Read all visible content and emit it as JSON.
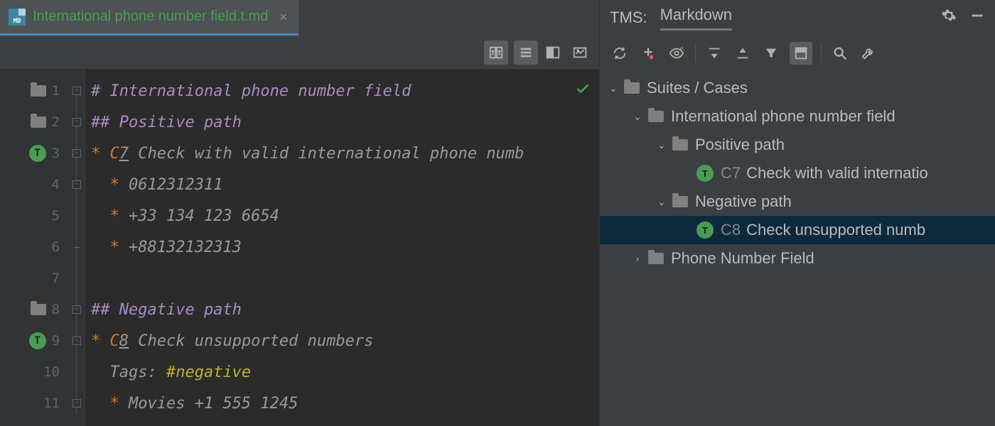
{
  "tab": {
    "icon_label": "MD",
    "title": "International phone number field.t.md"
  },
  "editor": {
    "lines": {
      "l1": "# International phone number field",
      "l2": "## Positive path",
      "l3_pre": "* C",
      "l3_link": "7",
      "l3_post": " Check with valid international phone numb",
      "l4_bullet": "  * ",
      "l4_text": "0612312311",
      "l5_bullet": "  * ",
      "l5_text": "+33 134 123 6654",
      "l6_bullet": "  * ",
      "l6_text": "+88132132313",
      "l8": "## Negative path",
      "l9_pre": "* C",
      "l9_link": "8",
      "l9_post": " Check unsupported numbers",
      "l10_pre": "  Tags: ",
      "l10_tag": "#negative",
      "l11_bullet": "  * ",
      "l11_text": "Movies +1 555 1245"
    },
    "line_numbers": [
      "1",
      "2",
      "3",
      "4",
      "5",
      "6",
      "7",
      "8",
      "9",
      "10",
      "11"
    ],
    "gutter_badge": "T"
  },
  "tms": {
    "label": "TMS:",
    "tab": "Markdown",
    "tree": {
      "root": "Suites / Cases",
      "suite": "International phone number field",
      "pos_path": "Positive path",
      "case7_no": "C7",
      "case7_title": "Check with valid internatio",
      "neg_path": "Negative path",
      "case8_no": "C8",
      "case8_title": "Check unsupported numb",
      "other_suite": "Phone Number Field",
      "badge": "T"
    }
  }
}
